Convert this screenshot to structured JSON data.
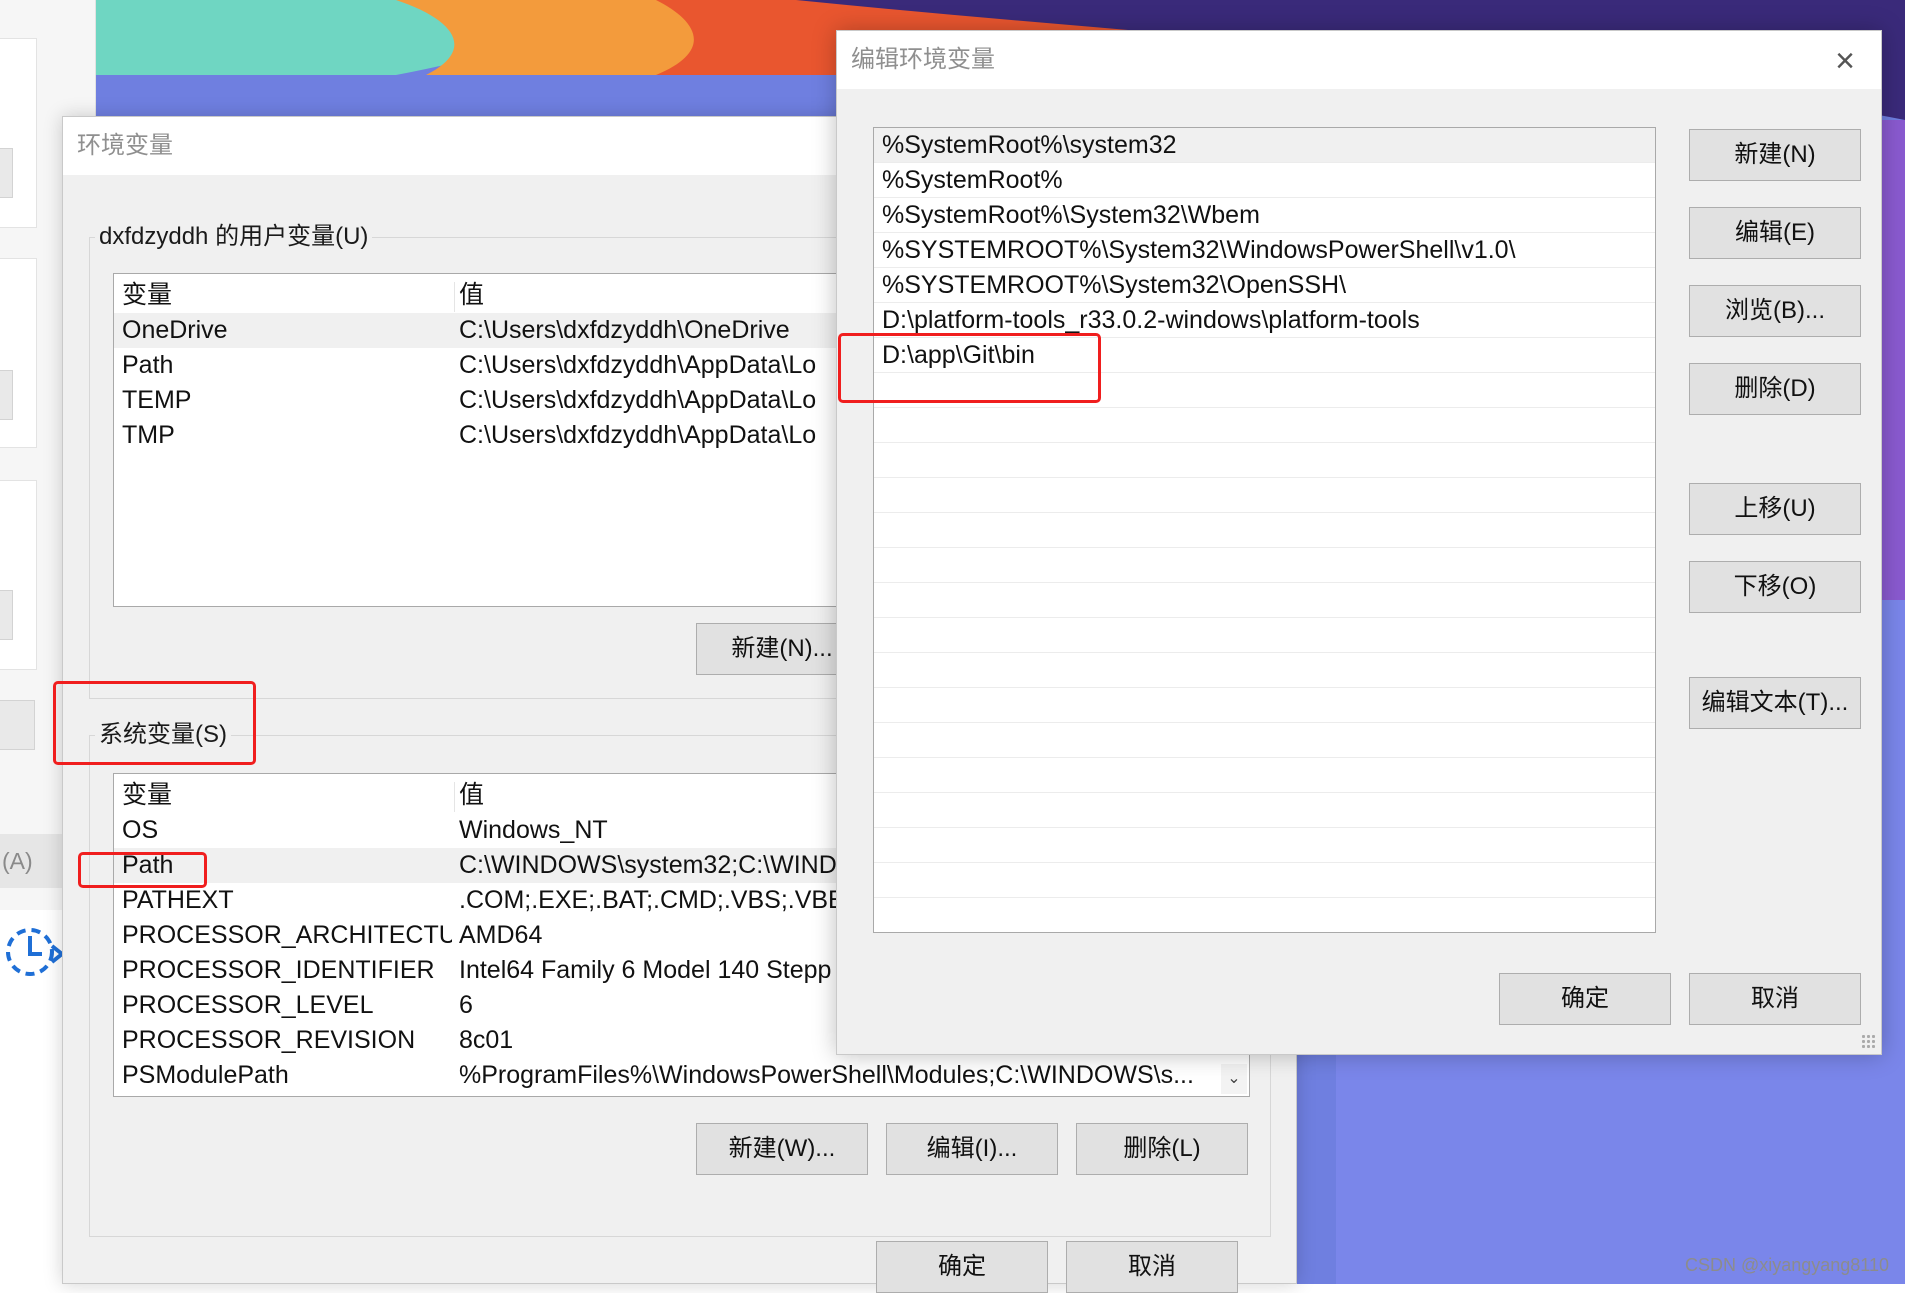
{
  "env_window": {
    "title": "环境变量",
    "user_group_label": "dxfdzyddh 的用户变量(U)",
    "user_vars": {
      "columns": [
        "变量",
        "值"
      ],
      "rows": [
        {
          "name": "OneDrive",
          "value": "C:\\Users\\dxfdzyddh\\OneDrive"
        },
        {
          "name": "Path",
          "value": "C:\\Users\\dxfdzyddh\\AppData\\Lo"
        },
        {
          "name": "TEMP",
          "value": "C:\\Users\\dxfdzyddh\\AppData\\Lo"
        },
        {
          "name": "TMP",
          "value": "C:\\Users\\dxfdzyddh\\AppData\\Lo"
        }
      ],
      "new_button": "新建(N)..."
    },
    "system_group_label": "系统变量(S)",
    "system_vars": {
      "columns": [
        "变量",
        "值"
      ],
      "rows": [
        {
          "name": "OS",
          "value": "Windows_NT"
        },
        {
          "name": "Path",
          "value": "C:\\WINDOWS\\system32;C:\\WIND"
        },
        {
          "name": "PATHEXT",
          "value": ".COM;.EXE;.BAT;.CMD;.VBS;.VBE;.J"
        },
        {
          "name": "PROCESSOR_ARCHITECTU...",
          "value": "AMD64"
        },
        {
          "name": "PROCESSOR_IDENTIFIER",
          "value": "Intel64 Family 6 Model 140 Stepp"
        },
        {
          "name": "PROCESSOR_LEVEL",
          "value": "6"
        },
        {
          "name": "PROCESSOR_REVISION",
          "value": "8c01"
        },
        {
          "name": "PSModulePath",
          "value": "%ProgramFiles%\\WindowsPowerShell\\Modules;C:\\WINDOWS\\s..."
        }
      ],
      "new_button": "新建(W)...",
      "edit_button": "编辑(I)...",
      "delete_button": "删除(L)"
    },
    "ok_button": "确定",
    "cancel_button": "取消"
  },
  "edit_window": {
    "title": "编辑环境变量",
    "entries": [
      "%SystemRoot%\\system32",
      "%SystemRoot%",
      "%SystemRoot%\\System32\\Wbem",
      "%SYSTEMROOT%\\System32\\WindowsPowerShell\\v1.0\\",
      "%SYSTEMROOT%\\System32\\OpenSSH\\",
      "D:\\platform-tools_r33.0.2-windows\\platform-tools",
      "D:\\app\\Git\\bin"
    ],
    "buttons": {
      "new": "新建(N)",
      "edit": "编辑(E)",
      "browse": "浏览(B)...",
      "delete": "删除(D)",
      "move_up": "上移(U)",
      "move_down": "下移(O)",
      "edit_text": "编辑文本(T)..."
    },
    "ok_button": "确定",
    "cancel_button": "取消"
  },
  "behind_window": {
    "apply_fragment": "(A)"
  },
  "watermark": "CSDN @xiyangyang8110",
  "colors": {
    "highlight_red": "#f01e1e",
    "window_bg": "#f0f0f0",
    "button_bg": "#e1e1e1"
  }
}
